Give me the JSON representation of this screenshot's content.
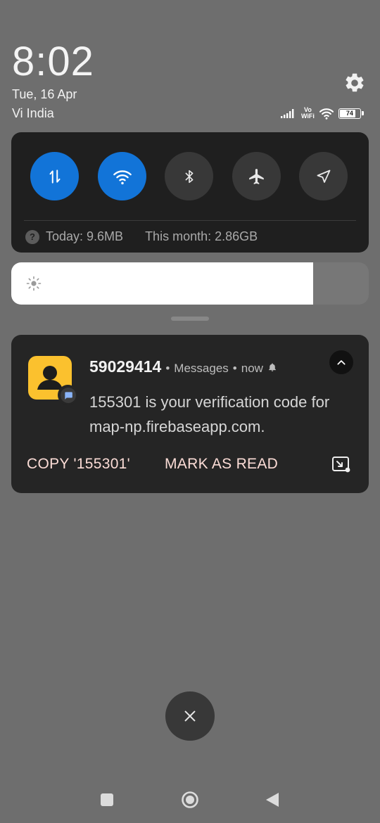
{
  "status": {
    "time": "8:02",
    "date": "Tue, 16 Apr",
    "carrier": "Vi India",
    "vowifi_top": "Vo",
    "vowifi_bottom": "WiFi",
    "battery": "74"
  },
  "quick_settings": {
    "tiles": [
      {
        "name": "mobile-data",
        "on": true
      },
      {
        "name": "wifi",
        "on": true
      },
      {
        "name": "bluetooth",
        "on": false
      },
      {
        "name": "airplane-mode",
        "on": false
      },
      {
        "name": "location",
        "on": false
      }
    ],
    "data_today": "Today: 9.6MB",
    "data_month": "This month: 2.86GB",
    "active_color": "#1274d8"
  },
  "brightness": {
    "level": 0.845
  },
  "notification": {
    "sender": "59029414",
    "app": "Messages",
    "time": "now",
    "body": "155301 is your verification code for map-np.firebaseapp.com.",
    "actions": {
      "copy": "COPY '155301'",
      "mark_read": "MARK AS READ"
    },
    "avatar_color": "#fbc12e",
    "action_color": "#fbdcd6"
  },
  "navigation": {
    "icons": [
      "square-recents-icon",
      "circle-home-icon",
      "triangle-back-icon"
    ]
  }
}
